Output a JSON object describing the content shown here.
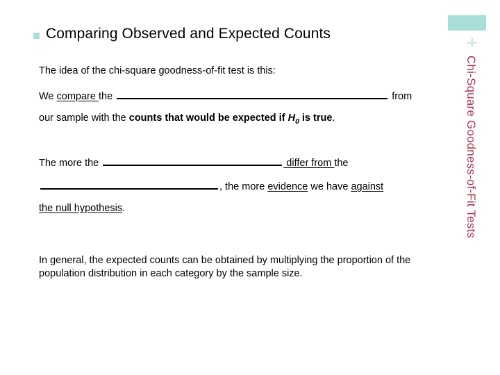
{
  "slide": {
    "title": "Comparing Observed and Expected Counts",
    "bullet_color": "#a9ddd8",
    "background_color": "#ffffff"
  },
  "body": {
    "intro_line": "The idea of the chi-square goodness-of-fit test is this:",
    "sentence1": {
      "part1": "We ",
      "underlined1": "compare ",
      "part2": "the ",
      "blank1": "",
      "part3": " from",
      "line2_part1": "our sample with the ",
      "line2_bold": "counts that would be expected if ",
      "line2_h": "H",
      "line2_h_sub": "0",
      "line2_bold2": " is true",
      "line2_end": "."
    },
    "sentence2": {
      "part1": "The more the ",
      "blank2": "",
      "underlined1": " differ from ",
      "part2": "the",
      "blank3": "",
      "part3": ", the more ",
      "underlined2": "evidence",
      "part4": " we have ",
      "underlined3": "against",
      "underlined4": "the null hypothesis",
      "part5": "."
    },
    "final_paragraph": "In general, the expected counts can be obtained by multiplying the proportion of the population distribution in each category by the sample size."
  },
  "sidebar": {
    "vertical_title": "Chi-Square Goodness-of-Fit Tests",
    "plus_symbol": "+",
    "block_color": "#a9ddd8",
    "plus_color": "#cfe9e6",
    "text_color": "#b0374c"
  }
}
